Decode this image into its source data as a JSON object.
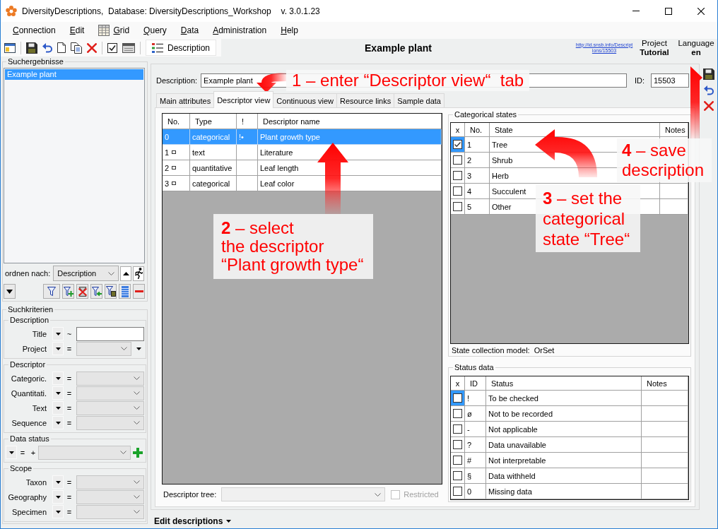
{
  "window": {
    "title": "DiversityDescriptions,  Database: DiversityDescriptions_Workshop",
    "version": "v. 3.0.1.23"
  },
  "menu": [
    {
      "label": "Connection",
      "kind": "text"
    },
    {
      "label": "Edit",
      "kind": "text"
    },
    {
      "label": "Grid",
      "kind": "grid"
    },
    {
      "label": "Query",
      "kind": "text"
    },
    {
      "label": "Data",
      "kind": "text"
    },
    {
      "label": "Administration",
      "kind": "text"
    },
    {
      "label": "Help",
      "kind": "text"
    }
  ],
  "toolbar": {
    "mode_button": "Description",
    "record_title": "Example plant",
    "link": "http://id.snsb.info/Descriptions/15503",
    "project_label": "Project",
    "project": "Tutorial",
    "language_label": "Language",
    "language": "en"
  },
  "search_results": {
    "title": "Suchergebnisse",
    "items": [
      {
        "label": "Example plant",
        "selected": true
      }
    ],
    "sort_label": "ordnen nach:",
    "sort_value": "Description"
  },
  "search_criteria": {
    "title": "Suchkriterien",
    "groups": [
      {
        "title": "Description",
        "fields": [
          {
            "label": "Title",
            "operator": "~",
            "kind": "text"
          },
          {
            "label": "Project",
            "operator": "=",
            "kind": "combo_more"
          }
        ]
      },
      {
        "title": "Descriptor",
        "fields": [
          {
            "label": "Categoric.",
            "operator": "=",
            "kind": "combo"
          },
          {
            "label": "Quantitati.",
            "operator": "=",
            "kind": "combo"
          },
          {
            "label": "Text",
            "operator": "=",
            "kind": "combo"
          },
          {
            "label": "Sequence",
            "operator": "=",
            "kind": "combo"
          }
        ]
      },
      {
        "title": "Data status",
        "fields": [
          {
            "operator": "=",
            "prefix": "+",
            "kind": "status"
          }
        ]
      },
      {
        "title": "Scope",
        "fields": [
          {
            "label": "Taxon",
            "operator": "=",
            "kind": "combo"
          },
          {
            "label": "Geography",
            "operator": "=",
            "kind": "combo"
          },
          {
            "label": "Specimen",
            "operator": "=",
            "kind": "combo"
          }
        ]
      }
    ]
  },
  "description": {
    "label": "Description:",
    "value": "Example plant",
    "id_label": "ID:",
    "id": "15503"
  },
  "tabs": [
    {
      "label": "Main attributes",
      "selected": false
    },
    {
      "label": "Descriptor view",
      "selected": true
    },
    {
      "label": "Continuous view",
      "selected": false
    },
    {
      "label": "Resource links",
      "selected": false
    },
    {
      "label": "Sample data",
      "selected": false
    }
  ],
  "descriptors": {
    "columns": [
      "No.",
      "Type",
      "!",
      "Descriptor name"
    ],
    "rows": [
      {
        "no": "0",
        "marker": false,
        "type": "categorical",
        "flag": "!•",
        "name": "Plant growth type",
        "selected": true
      },
      {
        "no": "1",
        "marker": true,
        "type": "text",
        "name": "Literature",
        "selected": false
      },
      {
        "no": "2",
        "marker": true,
        "type": "quantitative",
        "name": "Leaf length",
        "selected": false
      },
      {
        "no": "3",
        "marker": true,
        "type": "categorical",
        "name": "Leaf color",
        "selected": false
      }
    ]
  },
  "descriptor_tree": {
    "label": "Descriptor tree:",
    "disabled": true
  },
  "restricted": {
    "label": "Restricted",
    "checked": false,
    "disabled": true
  },
  "categorical_states": {
    "title": "Categorical states",
    "columns": [
      "x",
      "No.",
      "State",
      "Notes"
    ],
    "rows": [
      {
        "checked": true,
        "no": "1",
        "state": "Tree",
        "selected": true
      },
      {
        "checked": false,
        "no": "2",
        "state": "Shrub",
        "selected": false
      },
      {
        "checked": false,
        "no": "3",
        "state": "Herb",
        "selected": false
      },
      {
        "checked": false,
        "no": "4",
        "state": "Succulent",
        "selected": false
      },
      {
        "checked": false,
        "no": "5",
        "state": "Other",
        "selected": false
      }
    ],
    "model_label": "State collection model:",
    "model": "OrSet"
  },
  "status_data": {
    "title": "Status data",
    "columns": [
      "x",
      "ID",
      "Status",
      "Notes"
    ],
    "rows": [
      {
        "checked": false,
        "id": "!",
        "status": "To be checked",
        "selected": true
      },
      {
        "checked": false,
        "id": "ø",
        "status": "Not to be recorded",
        "selected": false
      },
      {
        "checked": false,
        "id": "-",
        "status": "Not applicable",
        "selected": false
      },
      {
        "checked": false,
        "id": "?",
        "status": "Data unavailable",
        "selected": false
      },
      {
        "checked": false,
        "id": "#",
        "status": "Not interpretable",
        "selected": false
      },
      {
        "checked": false,
        "id": "§",
        "status": "Data withheld",
        "selected": false
      },
      {
        "checked": false,
        "id": "0",
        "status": "Missing data",
        "selected": false
      }
    ]
  },
  "status_bar": {
    "label": "Edit descriptions"
  },
  "callouts": [
    {
      "kind": "hook_down",
      "text": "1 – enter “Descriptor view“  tab"
    },
    {
      "kind": "arrow_up",
      "text": "**2** – select\nthe descriptor\n“Plant growth type“"
    },
    {
      "kind": "curve_left",
      "text": "**3** – set the categorical state “Tree“"
    },
    {
      "kind": "hook_right",
      "text": "**4** – save description"
    }
  ]
}
